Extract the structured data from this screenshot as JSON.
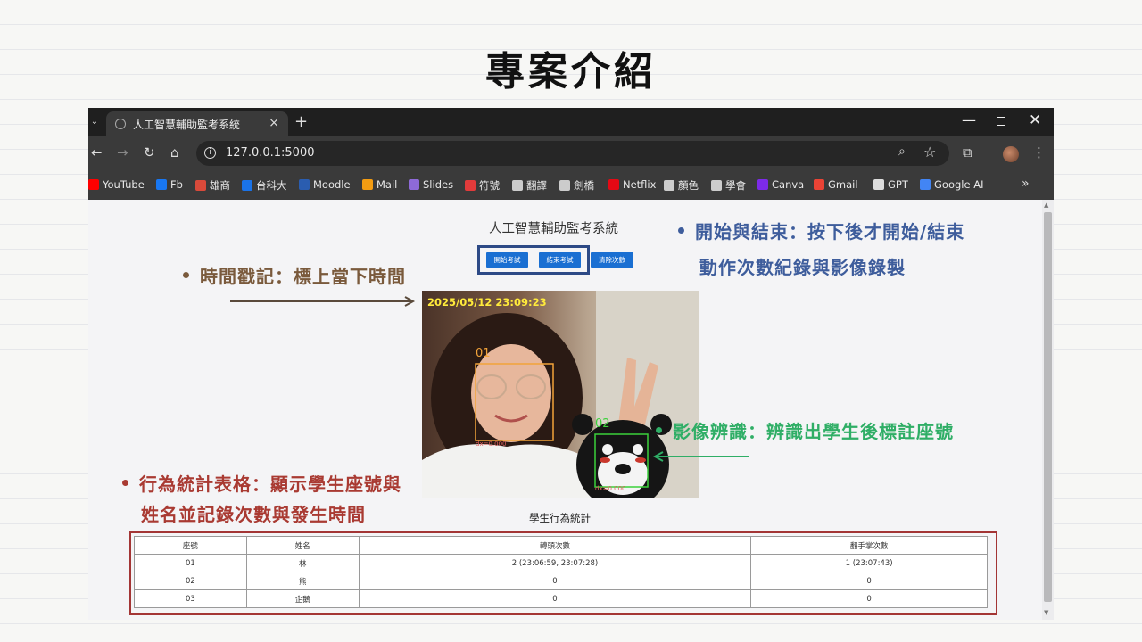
{
  "slide": {
    "title": "專案介紹"
  },
  "browser": {
    "tab_title": "人工智慧輔助監考系統",
    "tab_close": "×",
    "new_tab": "+",
    "url": "127.0.0.1:5000",
    "window": {
      "minimize": "—",
      "close": "✕"
    },
    "bookmarks": [
      {
        "label": "YouTube",
        "icon": "youtube-icon",
        "color": "#ff0000"
      },
      {
        "label": "Fb",
        "icon": "facebook-icon",
        "color": "#1877f2"
      },
      {
        "label": "雄商",
        "icon": "school-icon",
        "color": "#d94a3a"
      },
      {
        "label": "台科大",
        "icon": "globe-icon",
        "color": "#1a73e8"
      },
      {
        "label": "Moodle",
        "icon": "moodle-icon",
        "color": "#2a5db0"
      },
      {
        "label": "Mail",
        "icon": "mail-icon",
        "color": "#f39c12"
      },
      {
        "label": "Slides",
        "icon": "slides-icon",
        "color": "#8e6ad8"
      },
      {
        "label": "符號",
        "icon": "symbol-icon",
        "color": "#e23b3b"
      },
      {
        "label": "翻譯",
        "icon": "globe-icon",
        "color": "#cccccc"
      },
      {
        "label": "劍橋",
        "icon": "globe-icon",
        "color": "#cccccc"
      },
      {
        "label": "Netflix",
        "icon": "netflix-icon",
        "color": "#e50914"
      },
      {
        "label": "顏色",
        "icon": "globe-icon",
        "color": "#cccccc"
      },
      {
        "label": "學會",
        "icon": "globe-icon",
        "color": "#cccccc"
      },
      {
        "label": "Canva",
        "icon": "canva-icon",
        "color": "#7d2ae8"
      },
      {
        "label": "Gmail",
        "icon": "gmail-icon",
        "color": "#ea4335"
      },
      {
        "label": "GPT",
        "icon": "openai-icon",
        "color": "#dddddd"
      },
      {
        "label": "Google AI",
        "icon": "google-ai-icon",
        "color": "#4285f4"
      }
    ]
  },
  "app": {
    "title": "人工智慧輔助監考系統",
    "buttons": {
      "start": "開始考試",
      "end": "結束考試",
      "clear": "清除次數"
    },
    "video": {
      "timestamp": "2025/05/12 23:09:23",
      "detections": [
        {
          "seat": "01",
          "info": "dx=0.000",
          "color": "#f2a33a"
        },
        {
          "seat": "02",
          "info": "dx=0.000",
          "color": "#3bd13b"
        }
      ]
    },
    "stats": {
      "title": "學生行為統計",
      "columns": [
        "座號",
        "姓名",
        "轉頭次數",
        "翻手掌次數"
      ],
      "rows": [
        [
          "01",
          "林",
          "2 (23:06:59, 23:07:28)",
          "1 (23:07:43)"
        ],
        [
          "02",
          "熊",
          "0",
          "0"
        ],
        [
          "03",
          "企鵝",
          "0",
          "0"
        ]
      ]
    }
  },
  "annotations": {
    "timestamp": {
      "text": "時間戳記：標上當下時間",
      "color": "#7a5a3c"
    },
    "start_end": {
      "line1": "開始與結束：按下後才開始/結束",
      "line2": "動作次數紀錄與影像錄製",
      "color": "#3e5d9c"
    },
    "recognition": {
      "text": "影像辨識：辨識出學生後標註座號",
      "color": "#2fae66"
    },
    "stats_table": {
      "line1": "行為統計表格：顯示學生座號與",
      "line2": "姓名並記錄次數與發生時間",
      "color": "#a93a32"
    }
  }
}
